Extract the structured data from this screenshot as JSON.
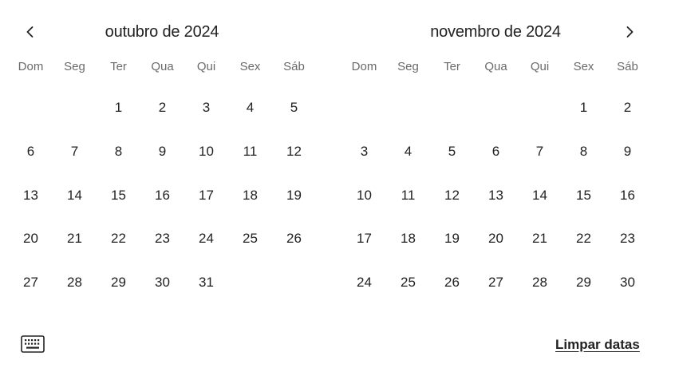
{
  "calendar": {
    "weekdays": [
      "Dom",
      "Seg",
      "Ter",
      "Qua",
      "Qui",
      "Sex",
      "Sáb"
    ],
    "months": [
      {
        "title": "outubro de 2024",
        "leading_blanks": 2,
        "days": [
          "1",
          "2",
          "3",
          "4",
          "5",
          "6",
          "7",
          "8",
          "9",
          "10",
          "11",
          "12",
          "13",
          "14",
          "15",
          "16",
          "17",
          "18",
          "19",
          "20",
          "21",
          "22",
          "23",
          "24",
          "25",
          "26",
          "27",
          "28",
          "29",
          "30",
          "31"
        ]
      },
      {
        "title": "novembro de 2024",
        "leading_blanks": 5,
        "days": [
          "1",
          "2",
          "3",
          "4",
          "5",
          "6",
          "7",
          "8",
          "9",
          "10",
          "11",
          "12",
          "13",
          "14",
          "15",
          "16",
          "17",
          "18",
          "19",
          "20",
          "21",
          "22",
          "23",
          "24",
          "25",
          "26",
          "27",
          "28",
          "29",
          "30"
        ]
      }
    ]
  },
  "footer": {
    "clear_label": "Limpar datas"
  },
  "icons": {
    "prev": "chevron-left-icon",
    "next": "chevron-right-icon",
    "keyboard": "keyboard-icon"
  }
}
